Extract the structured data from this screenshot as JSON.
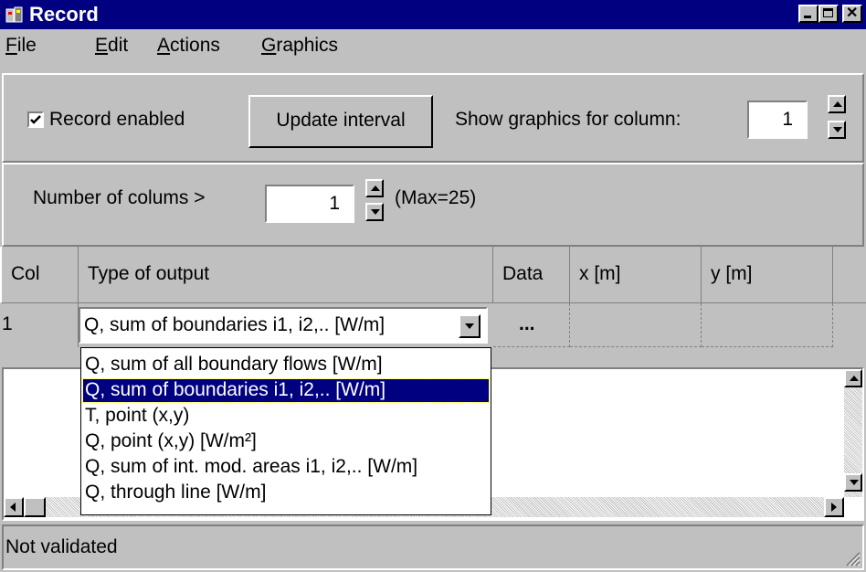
{
  "window": {
    "title": "Record"
  },
  "menu": {
    "items": [
      {
        "label": "File",
        "accel": "F",
        "rest": "ile"
      },
      {
        "label": "Edit",
        "accel": "E",
        "rest": "dit"
      },
      {
        "label": "Actions",
        "accel": "A",
        "rest": "ctions"
      },
      {
        "label": "Graphics",
        "accel": "G",
        "rest": "raphics"
      }
    ]
  },
  "toolbar": {
    "record_enabled_label": "Record enabled",
    "record_enabled_checked": true,
    "update_interval_label": "Update interval",
    "show_graphics_label": "Show graphics for column:",
    "show_graphics_value": "1"
  },
  "columns_panel": {
    "label": "Number of colums  >",
    "value": "1",
    "max_text": "(Max=25)"
  },
  "grid": {
    "headers": [
      "Col",
      "Type of output",
      "Data",
      "x [m]",
      "y [m]"
    ],
    "rows": [
      {
        "col": "1",
        "type": "Q, sum of boundaries i1, i2,.. [W/m]",
        "data": "...",
        "x": "",
        "y": ""
      }
    ]
  },
  "dropdown": {
    "selected_index": 1,
    "options": [
      "Q, sum of all boundary flows [W/m]",
      "Q, sum of boundaries i1, i2,.. [W/m]",
      "T, point (x,y)",
      "Q, point (x,y)  [W/m²]",
      "Q, sum of int. mod. areas i1, i2,.. [W/m]",
      "Q, through line  [W/m]"
    ]
  },
  "status": {
    "text": "Not validated"
  },
  "colors": {
    "titlebar": "#000080",
    "face": "#c0c0c0",
    "selection": "#000080"
  }
}
